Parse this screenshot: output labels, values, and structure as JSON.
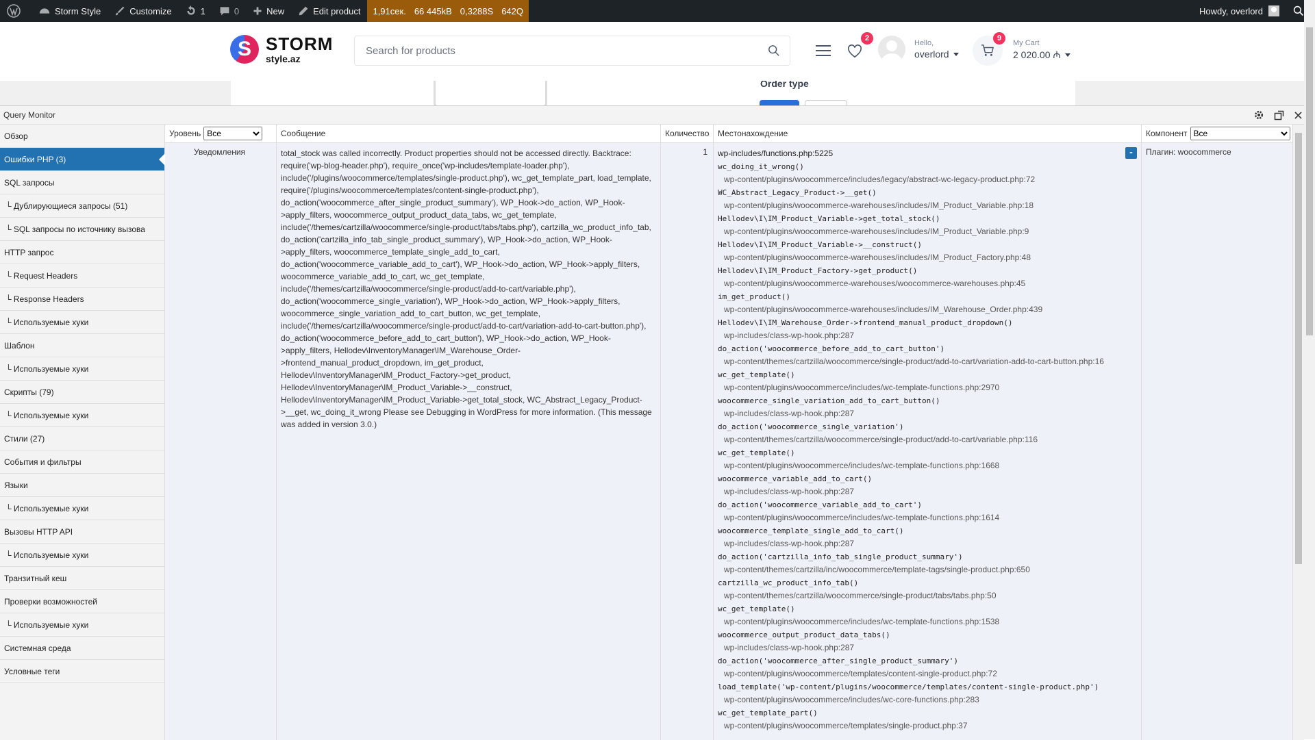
{
  "adminbar": {
    "site_name": "Storm Style",
    "customize": "Customize",
    "updates": "1",
    "comments": "0",
    "new": "New",
    "edit_product": "Edit product",
    "perf_time": "1,91сек.",
    "perf_mem": "66 445kB",
    "perf_db": "0,3288S",
    "perf_queries": "642Q",
    "howdy": "Howdy, overlord"
  },
  "header": {
    "logo_main": "STORM",
    "logo_sub": "style.az",
    "search_placeholder": "Search for products",
    "wishlist_count": "2",
    "hello": "Hello,",
    "username": "overlord",
    "cart_count": "9",
    "cart_label": "My Cart",
    "cart_total": "2 020.00 ₼"
  },
  "page": {
    "order_type": "Order type"
  },
  "qm": {
    "title": "Query Monitor",
    "nav": [
      {
        "label": "Обзор",
        "sub": false,
        "active": false
      },
      {
        "label": "Ошибки PHP (3)",
        "sub": false,
        "active": true
      },
      {
        "label": "SQL запросы",
        "sub": false,
        "active": false
      },
      {
        "label": "└ Дублирующиеся запросы (51)",
        "sub": true,
        "active": false
      },
      {
        "label": "└ SQL запросы по источнику вызова",
        "sub": true,
        "active": false
      },
      {
        "label": "HTTP запрос",
        "sub": false,
        "active": false
      },
      {
        "label": "└ Request Headers",
        "sub": true,
        "active": false
      },
      {
        "label": "└ Response Headers",
        "sub": true,
        "active": false
      },
      {
        "label": "└ Используемые хуки",
        "sub": true,
        "active": false
      },
      {
        "label": "Шаблон",
        "sub": false,
        "active": false
      },
      {
        "label": "└ Используемые хуки",
        "sub": true,
        "active": false
      },
      {
        "label": "Скрипты (79)",
        "sub": false,
        "active": false
      },
      {
        "label": "└ Используемые хуки",
        "sub": true,
        "active": false
      },
      {
        "label": "Стили (27)",
        "sub": false,
        "active": false
      },
      {
        "label": "События и фильтры",
        "sub": false,
        "active": false
      },
      {
        "label": "Языки",
        "sub": false,
        "active": false
      },
      {
        "label": "└ Используемые хуки",
        "sub": true,
        "active": false
      },
      {
        "label": "Вызовы HTTP API",
        "sub": false,
        "active": false
      },
      {
        "label": "└ Используемые хуки",
        "sub": true,
        "active": false
      },
      {
        "label": "Транзитный кеш",
        "sub": false,
        "active": false
      },
      {
        "label": "Проверки возможностей",
        "sub": false,
        "active": false
      },
      {
        "label": "└ Используемые хуки",
        "sub": true,
        "active": false
      },
      {
        "label": "Системная среда",
        "sub": false,
        "active": false
      },
      {
        "label": "Условные теги",
        "sub": false,
        "active": false
      }
    ],
    "columns": {
      "level": "Уровень",
      "level_filter": "Все",
      "message": "Сообщение",
      "count": "Количество",
      "location": "Местонахождение",
      "component": "Компонент",
      "component_filter": "Все"
    },
    "row": {
      "level": "Уведомления",
      "message": "total_stock was called incorrectly. Product properties should not be accessed directly. Backtrace: require('wp-blog-header.php'), require_once('wp-includes/template-loader.php'), include('/plugins/woocommerce/templates/single-product.php'), wc_get_template_part, load_template, require('/plugins/woocommerce/templates/content-single-product.php'), do_action('woocommerce_after_single_product_summary'), WP_Hook->do_action, WP_Hook->apply_filters, woocommerce_output_product_data_tabs, wc_get_template, include('/themes/cartzilla/woocommerce/single-product/tabs/tabs.php'), cartzilla_wc_product_info_tab, do_action('cartzilla_info_tab_single_product_summary'), WP_Hook->do_action, WP_Hook->apply_filters, woocommerce_template_single_add_to_cart, do_action('woocommerce_variable_add_to_cart'), WP_Hook->do_action, WP_Hook->apply_filters, woocommerce_variable_add_to_cart, wc_get_template, include('/themes/cartzilla/woocommerce/single-product/add-to-cart/variable.php'), do_action('woocommerce_single_variation'), WP_Hook->do_action, WP_Hook->apply_filters, woocommerce_single_variation_add_to_cart_button, wc_get_template, include('/themes/cartzilla/woocommerce/single-product/add-to-cart/variation-add-to-cart-button.php'), do_action('woocommerce_before_add_to_cart_button'), WP_Hook->do_action, WP_Hook->apply_filters, Hellodev\\InventoryManager\\IM_Warehouse_Order->frontend_manual_product_dropdown, im_get_product, Hellodev\\InventoryManager\\IM_Product_Factory->get_product, Hellodev\\InventoryManager\\IM_Product_Variable->__construct, Hellodev\\InventoryManager\\IM_Product_Variable->get_total_stock, WC_Abstract_Legacy_Product->__get, wc_doing_it_wrong Please see Debugging in WordPress for more information. (This message was added in version 3.0.)",
      "count": "1",
      "component": "Плагин: woocommerce",
      "toggle": "-",
      "trace": [
        {
          "t": "path0",
          "v": "wp-includes/functions.php:5225"
        },
        {
          "t": "fn",
          "v": "wc_doing_it_wrong()"
        },
        {
          "t": "path",
          "v": "wp-content/plugins/woocommerce/includes/legacy/abstract-wc-legacy-product.php:72"
        },
        {
          "t": "fn",
          "v": "WC_Abstract_Legacy_Product->__get()"
        },
        {
          "t": "path",
          "v": "wp-content/plugins/woocommerce-warehouses/includes/IM_Product_Variable.php:18"
        },
        {
          "t": "fn",
          "v": "Hellodev\\I\\IM_Product_Variable->get_total_stock()"
        },
        {
          "t": "path",
          "v": "wp-content/plugins/woocommerce-warehouses/includes/IM_Product_Variable.php:9"
        },
        {
          "t": "fn",
          "v": "Hellodev\\I\\IM_Product_Variable->__construct()"
        },
        {
          "t": "path",
          "v": "wp-content/plugins/woocommerce-warehouses/includes/IM_Product_Factory.php:48"
        },
        {
          "t": "fn",
          "v": "Hellodev\\I\\IM_Product_Factory->get_product()"
        },
        {
          "t": "path",
          "v": "wp-content/plugins/woocommerce-warehouses/woocommerce-warehouses.php:45"
        },
        {
          "t": "fn",
          "v": "im_get_product()"
        },
        {
          "t": "path",
          "v": "wp-content/plugins/woocommerce-warehouses/includes/IM_Warehouse_Order.php:439"
        },
        {
          "t": "fn",
          "v": "Hellodev\\I\\IM_Warehouse_Order->frontend_manual_product_dropdown()"
        },
        {
          "t": "path",
          "v": "wp-includes/class-wp-hook.php:287"
        },
        {
          "t": "fn",
          "v": "do_action('woocommerce_before_add_to_cart_button')"
        },
        {
          "t": "path",
          "v": "wp-content/themes/cartzilla/woocommerce/single-product/add-to-cart/variation-add-to-cart-button.php:16"
        },
        {
          "t": "fn",
          "v": "wc_get_template()"
        },
        {
          "t": "path",
          "v": "wp-content/plugins/woocommerce/includes/wc-template-functions.php:2970"
        },
        {
          "t": "fn",
          "v": "woocommerce_single_variation_add_to_cart_button()"
        },
        {
          "t": "path",
          "v": "wp-includes/class-wp-hook.php:287"
        },
        {
          "t": "fn",
          "v": "do_action('woocommerce_single_variation')"
        },
        {
          "t": "path",
          "v": "wp-content/themes/cartzilla/woocommerce/single-product/add-to-cart/variable.php:116"
        },
        {
          "t": "fn",
          "v": "wc_get_template()"
        },
        {
          "t": "path",
          "v": "wp-content/plugins/woocommerce/includes/wc-template-functions.php:1668"
        },
        {
          "t": "fn",
          "v": "woocommerce_variable_add_to_cart()"
        },
        {
          "t": "path",
          "v": "wp-includes/class-wp-hook.php:287"
        },
        {
          "t": "fn",
          "v": "do_action('woocommerce_variable_add_to_cart')"
        },
        {
          "t": "path",
          "v": "wp-content/plugins/woocommerce/includes/wc-template-functions.php:1614"
        },
        {
          "t": "fn",
          "v": "woocommerce_template_single_add_to_cart()"
        },
        {
          "t": "path",
          "v": "wp-includes/class-wp-hook.php:287"
        },
        {
          "t": "fn",
          "v": "do_action('cartzilla_info_tab_single_product_summary')"
        },
        {
          "t": "path",
          "v": "wp-content/themes/cartzilla/inc/woocommerce/template-tags/single-product.php:650"
        },
        {
          "t": "fn",
          "v": "cartzilla_wc_product_info_tab()"
        },
        {
          "t": "path",
          "v": "wp-content/themes/cartzilla/woocommerce/single-product/tabs/tabs.php:50"
        },
        {
          "t": "fn",
          "v": "wc_get_template()"
        },
        {
          "t": "path",
          "v": "wp-content/plugins/woocommerce/includes/wc-template-functions.php:1538"
        },
        {
          "t": "fn",
          "v": "woocommerce_output_product_data_tabs()"
        },
        {
          "t": "path",
          "v": "wp-includes/class-wp-hook.php:287"
        },
        {
          "t": "fn",
          "v": "do_action('woocommerce_after_single_product_summary')"
        },
        {
          "t": "path",
          "v": "wp-content/plugins/woocommerce/templates/content-single-product.php:72"
        },
        {
          "t": "fn",
          "v": "load_template('wp-content/plugins/woocommerce/templates/content-single-product.php')"
        },
        {
          "t": "path",
          "v": "wp-content/plugins/woocommerce/includes/wc-core-functions.php:283"
        },
        {
          "t": "fn",
          "v": "wc_get_template_part()"
        },
        {
          "t": "path",
          "v": "wp-content/plugins/woocommerce/templates/single-product.php:37"
        }
      ]
    }
  },
  "colors": {
    "adminbar": "#1d2327",
    "qm_perf": "#9a5b0a",
    "qm_active": "#2271b1",
    "badge": "#f3325e"
  }
}
